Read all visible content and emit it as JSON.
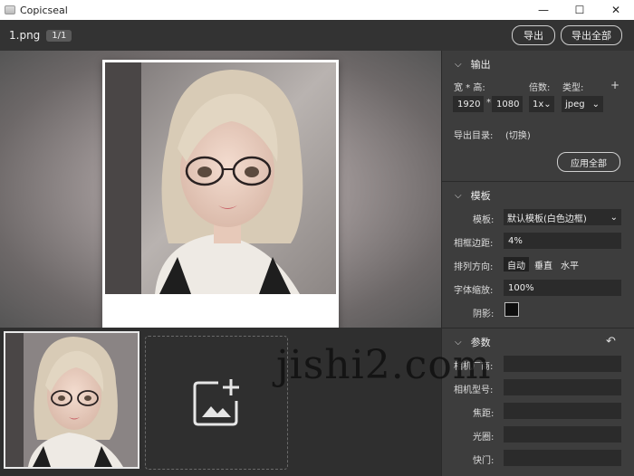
{
  "window": {
    "title": "Copicseal",
    "minimize": "—",
    "maximize": "☐",
    "close": "✕"
  },
  "toolbar": {
    "filename": "1.png",
    "page_indicator": "1/1",
    "export_label": "导出",
    "export_all_label": "导出全部"
  },
  "panel": {
    "output": {
      "title": "输出",
      "size_label": "宽 * 高:",
      "multiplier_label": "倍数:",
      "type_label": "类型:",
      "add": "+",
      "width": "1920",
      "times": "*",
      "height": "1080",
      "multiplier": "1x",
      "type": "jpeg",
      "dir_label": "导出目录:",
      "dir_change": "(切换)",
      "apply_all": "应用全部"
    },
    "template": {
      "title": "模板",
      "template_label": "模板:",
      "template_value": "默认模板(白色边框)",
      "border_label": "相框边距:",
      "border_value": "4%",
      "direction_label": "排列方向:",
      "directions": [
        "自动",
        "垂直",
        "水平"
      ],
      "active_direction": "自动",
      "font_scale_label": "字体缩放:",
      "font_scale_value": "100%",
      "shadow_label": "阴影:",
      "shadow_color": "#0e0e0e"
    },
    "params": {
      "title": "参数",
      "reset_icon": "undo-icon",
      "fields": [
        "相机厂商:",
        "相机型号:",
        "焦距:",
        "光圈:",
        "快门:"
      ]
    }
  },
  "watermark": "jishi2.com"
}
